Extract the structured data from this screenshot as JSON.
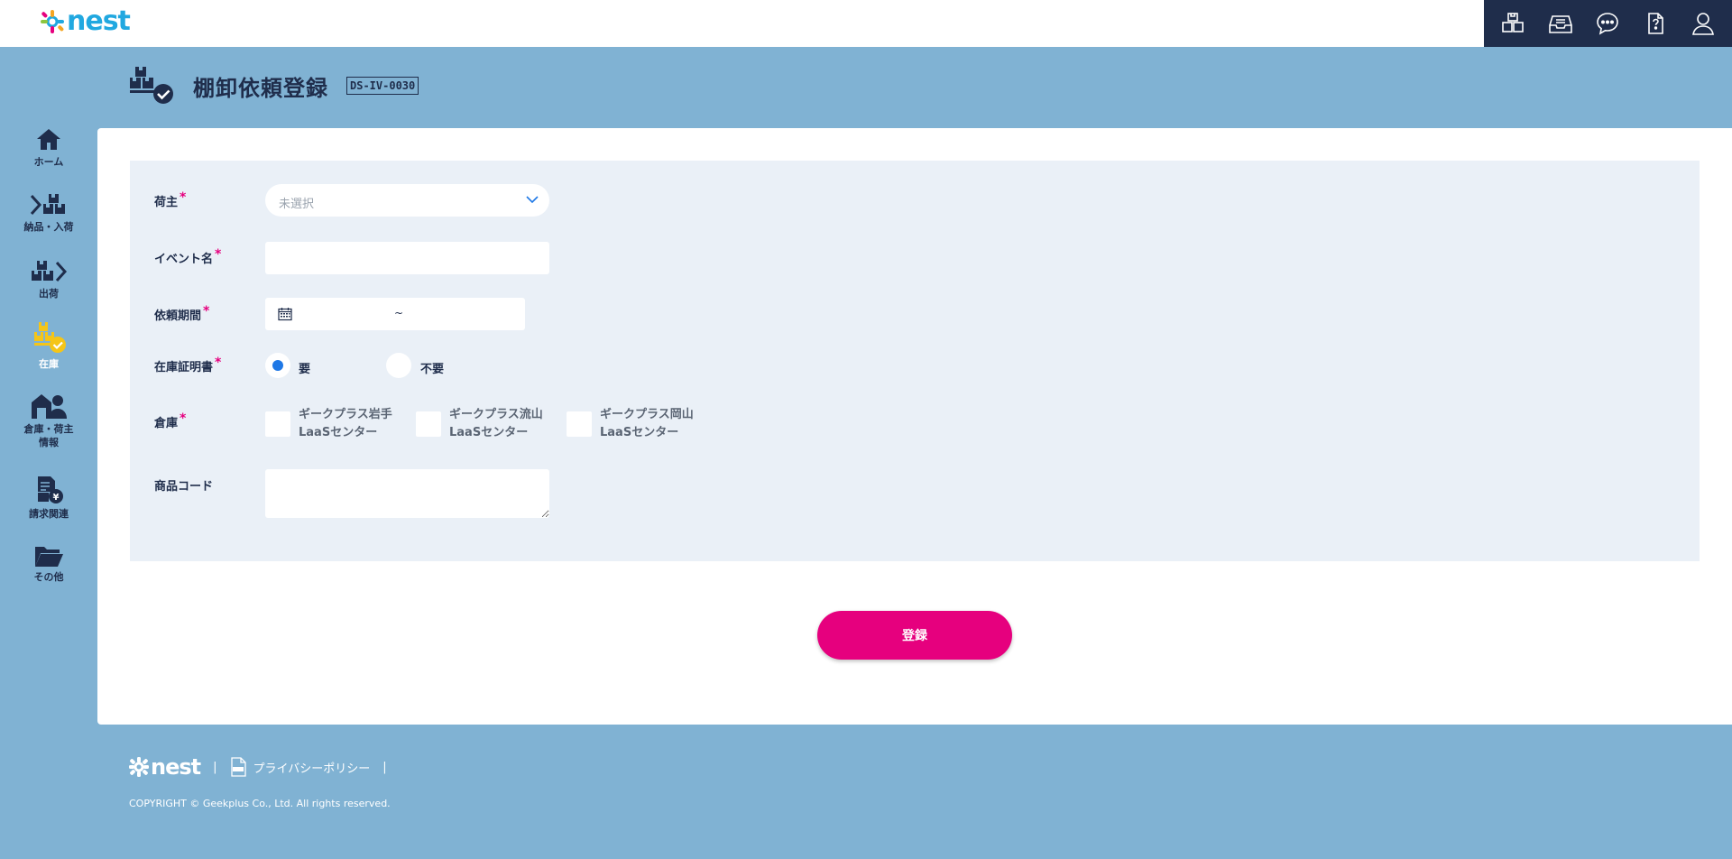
{
  "header": {
    "logo_text": "nest",
    "icons": [
      "warehouse-box-icon",
      "inbox-tray-icon",
      "chat-bubble-icon",
      "help-document-icon",
      "user-profile-icon"
    ]
  },
  "page": {
    "title": "棚卸依頼登録",
    "code": "DS-IV-0030"
  },
  "sidebar": {
    "items": [
      {
        "label": "ホーム",
        "icon": "home-icon"
      },
      {
        "label": "納品・入荷",
        "icon": "inbound-icon"
      },
      {
        "label": "出荷",
        "icon": "outbound-icon"
      },
      {
        "label": "在庫",
        "icon": "inventory-icon",
        "active": true
      },
      {
        "label": "倉庫・荷主",
        "label2": "情報",
        "icon": "warehouse-owner-icon"
      },
      {
        "label": "請求関連",
        "icon": "billing-icon"
      },
      {
        "label": "その他",
        "icon": "folder-icon"
      }
    ]
  },
  "form": {
    "owner": {
      "label": "荷主",
      "required": "*",
      "placeholder": "未選択"
    },
    "event_name": {
      "label": "イベント名",
      "required": "*",
      "value": ""
    },
    "period": {
      "label": "依頼期間",
      "required": "*",
      "separator": "~"
    },
    "certificate": {
      "label": "在庫証明書",
      "required": "*",
      "options": [
        {
          "label": "要",
          "selected": true
        },
        {
          "label": "不要",
          "selected": false
        }
      ]
    },
    "warehouse": {
      "label": "倉庫",
      "required": "*",
      "options": [
        {
          "line1": "ギークプラス岩手",
          "line2": "LaaSセンター"
        },
        {
          "line1": "ギークプラス流山",
          "line2": "LaaSセンター"
        },
        {
          "line1": "ギークプラス岡山",
          "line2": "LaaSセンター"
        }
      ]
    },
    "product_code": {
      "label": "商品コード",
      "value": ""
    },
    "submit_label": "登録"
  },
  "footer": {
    "logo_text": "nest",
    "sep1": "|",
    "privacy_label": "プライバシーポリシー",
    "sep2": "|",
    "copyright": "COPYRIGHT © Geekplus Co., Ltd. All rights reserved."
  },
  "colors": {
    "navy": "#1f2d4b",
    "background": "#80b2d3",
    "accent_pink": "#e6007e",
    "active_yellow": "#f5c518",
    "radio_blue": "#1e78e6",
    "logo_blue": "#21a8e0"
  }
}
